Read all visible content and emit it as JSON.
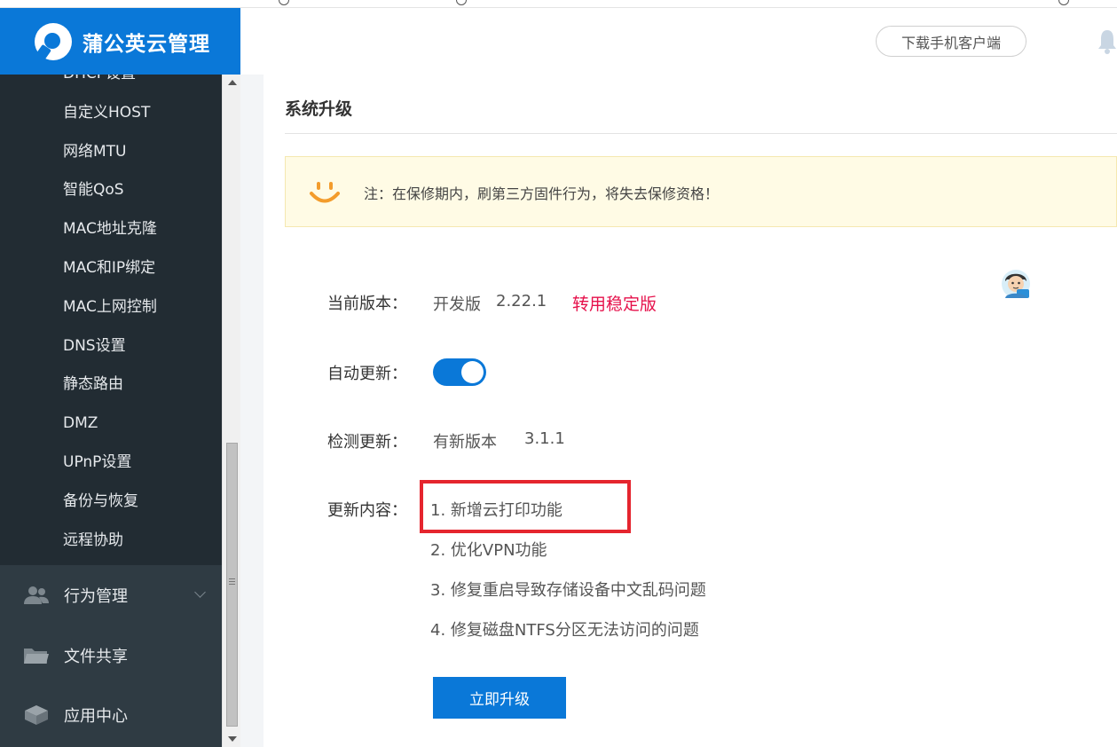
{
  "brand": {
    "name": "蒲公英云管理",
    "color": "#0a78d8"
  },
  "header": {
    "download_label": "下载手机客户端",
    "bell_icon": "bell-icon"
  },
  "sidebar": {
    "partial_top_item": "DHCP设置",
    "sub_items": [
      "自定义HOST",
      "网络MTU",
      "智能QoS",
      "MAC地址克隆",
      "MAC和IP绑定",
      "MAC上网控制",
      "DNS设置",
      "静态路由",
      "DMZ",
      "UPnP设置",
      "备份与恢复",
      "远程协助"
    ],
    "main_items": [
      {
        "label": "行为管理",
        "icon": "users-icon"
      },
      {
        "label": "文件共享",
        "icon": "folder-icon"
      },
      {
        "label": "应用中心",
        "icon": "box-icon"
      }
    ]
  },
  "main": {
    "title": "系统升级",
    "notice": "注：在保修期内，刷第三方固件行为，将失去保修资格！",
    "current_version": {
      "label": "当前版本：",
      "edition": "开发版",
      "version": "2.22.1",
      "switch_link": "转用稳定版"
    },
    "auto_update": {
      "label": "自动更新：",
      "enabled": true
    },
    "check_update": {
      "label": "检测更新：",
      "status": "有新版本",
      "version": "3.1.1"
    },
    "changelog": {
      "label": "更新内容：",
      "items": [
        "1. 新增云打印功能",
        "2. 优化VPN功能",
        "3. 修复重启导致存储设备中文乱码问题",
        "4. 修复磁盘NTFS分区无法访问的问题"
      ]
    },
    "upgrade_button": "立即升级"
  },
  "colors": {
    "accent": "#0a78d8",
    "danger": "#e6114b",
    "highlight": "#e5252e",
    "sidebar_bg": "#243038"
  }
}
